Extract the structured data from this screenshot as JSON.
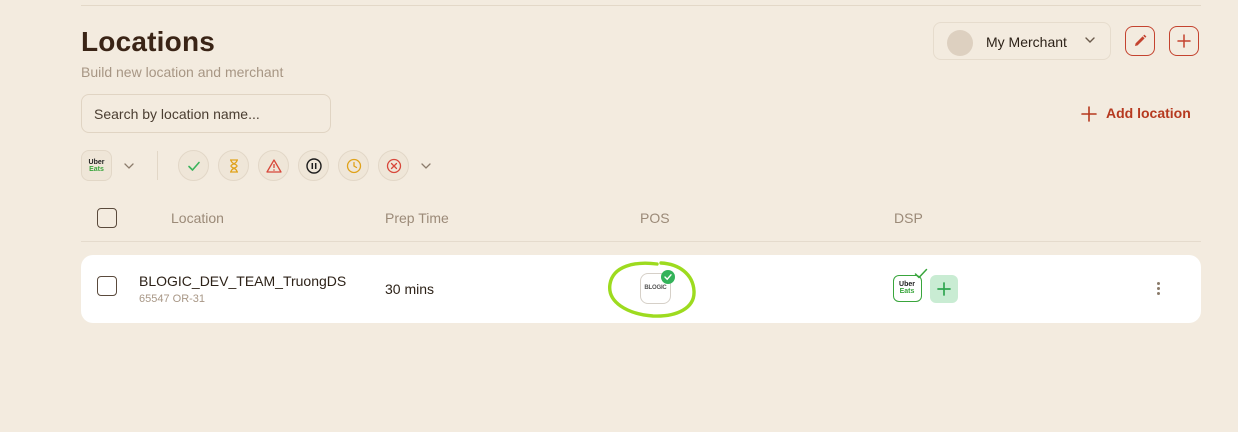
{
  "header": {
    "title": "Locations",
    "subtitle": "Build new location and merchant"
  },
  "merchant_selector": {
    "label": "My Merchant"
  },
  "search": {
    "placeholder": "Search by location name..."
  },
  "actions": {
    "add_location": "Add location"
  },
  "filters": {
    "platform": {
      "icon": "uber-eats-logo",
      "line1": "Uber",
      "line2": "Eats"
    },
    "statuses": [
      {
        "icon": "check-icon",
        "color": "#3bb45c"
      },
      {
        "icon": "hourglass-icon",
        "color": "#e0a21a"
      },
      {
        "icon": "warning-icon",
        "color": "#d8473a"
      },
      {
        "icon": "pause-icon",
        "color": "#1c1c1c"
      },
      {
        "icon": "clock-icon",
        "color": "#e0a21a"
      },
      {
        "icon": "close-circle-icon",
        "color": "#d8473a"
      }
    ]
  },
  "table": {
    "columns": [
      "Location",
      "Prep Time",
      "POS",
      "DSP"
    ],
    "rows": [
      {
        "name": "BLOGIC_DEV_TEAM_TruongDS",
        "sub": "65547 OR-31",
        "prep_time": "30 mins",
        "pos_logo": "BLOGIC",
        "pos_connected": true,
        "dsp": {
          "line1": "Uber",
          "line2": "Eats",
          "connected": true
        }
      }
    ]
  },
  "colors": {
    "background": "#f3ebdf",
    "accent": "#c4432f",
    "success": "#33b35a",
    "highlight_annotation": "#9ddb1f"
  }
}
